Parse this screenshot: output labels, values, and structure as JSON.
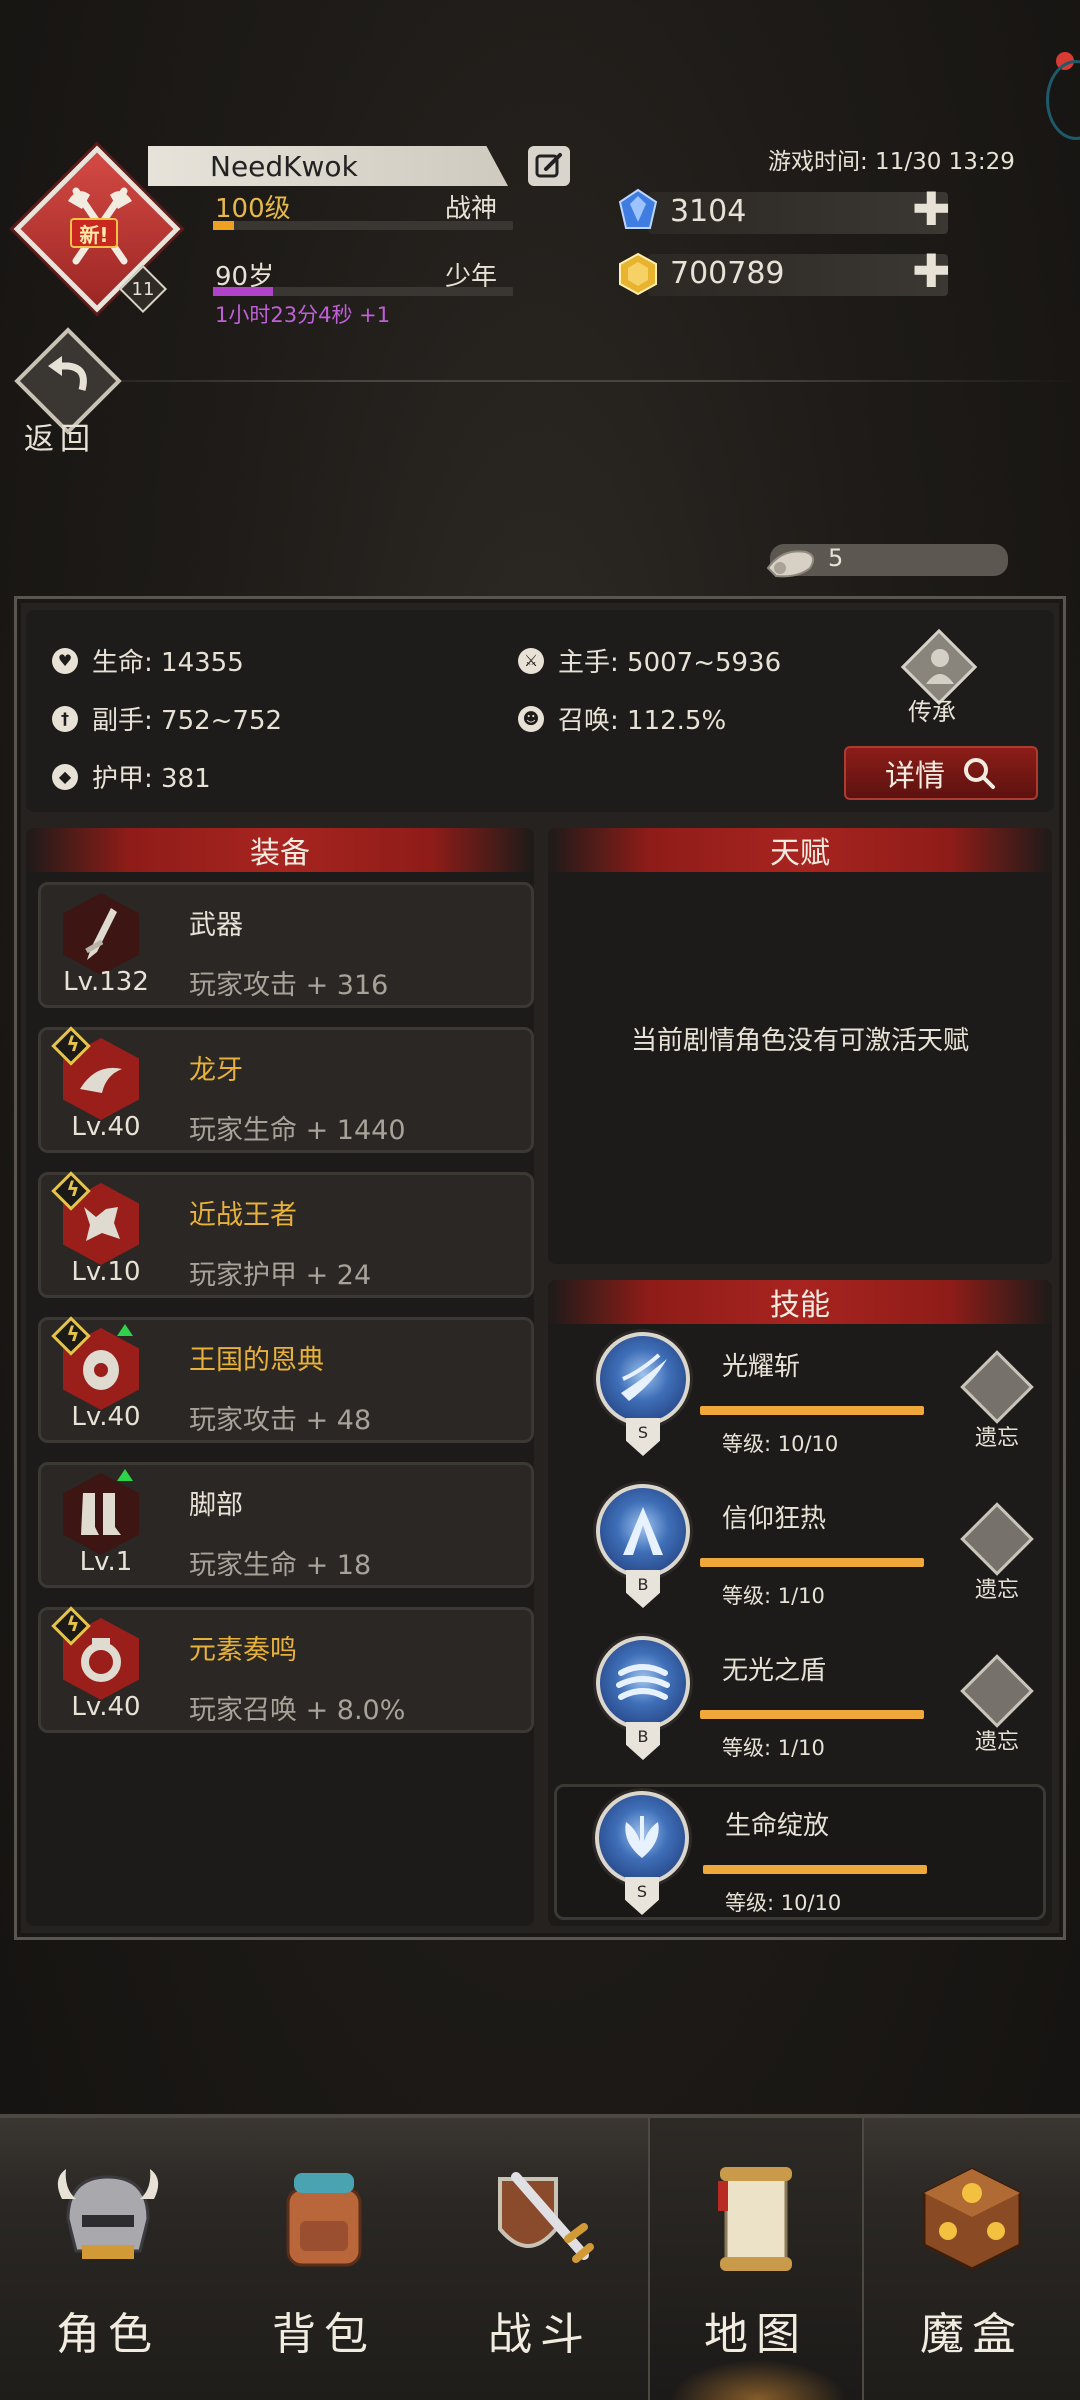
{
  "header": {
    "new_tag": "新!",
    "avatar_level": "11",
    "player_name": "NeedKwok",
    "level": "100级",
    "title": "战神",
    "exp_progress": 0.07,
    "age": "90岁",
    "stage": "少年",
    "age_progress": 0.2,
    "age_timer": "1小时23分4秒 +1",
    "game_time": "游戏时间: 11/30 13:29",
    "gems": "3104",
    "gold": "700789",
    "back_label": "返回",
    "scroll_count": "5"
  },
  "stats": {
    "hp": "生命: 14355",
    "main_hand": "主手: 5007~5936",
    "off_hand": "副手: 752~752",
    "summon": "召唤: 112.5%",
    "armor": "护甲: 381",
    "inherit_label": "传承",
    "detail_label": "详情"
  },
  "equipment": {
    "header": "装备",
    "items": [
      {
        "level": "Lv.132",
        "name": "武器",
        "stat": "玩家攻击 + 316"
      },
      {
        "level": "Lv.40",
        "name": "龙牙",
        "stat": "玩家生命 + 1440"
      },
      {
        "level": "Lv.10",
        "name": "近战王者",
        "stat": "玩家护甲 + 24"
      },
      {
        "level": "Lv.40",
        "name": "王国的恩典",
        "stat": "玩家攻击 + 48"
      },
      {
        "level": "Lv.1",
        "name": "脚部",
        "stat": "玩家生命 + 18"
      },
      {
        "level": "Lv.40",
        "name": "元素奏鸣",
        "stat": "玩家召唤 + 8.0%"
      }
    ]
  },
  "talent": {
    "header": "天赋",
    "empty_text": "当前剧情角色没有可激活天赋"
  },
  "skills": {
    "header": "技能",
    "forget_label": "遗忘",
    "items": [
      {
        "name": "光耀斩",
        "grade": "S",
        "level": "等级: 10/10"
      },
      {
        "name": "信仰狂热",
        "grade": "B",
        "level": "等级: 1/10"
      },
      {
        "name": "无光之盾",
        "grade": "B",
        "level": "等级: 1/10"
      },
      {
        "name": "生命绽放",
        "grade": "S",
        "level": "等级: 10/10"
      }
    ]
  },
  "nav": {
    "items": [
      {
        "label": "角色",
        "icon": "helmet-icon"
      },
      {
        "label": "背包",
        "icon": "backpack-icon"
      },
      {
        "label": "战斗",
        "icon": "sword-shield-icon"
      },
      {
        "label": "地图",
        "icon": "map-scroll-icon"
      },
      {
        "label": "魔盒",
        "icon": "magic-box-icon"
      }
    ],
    "active_index": 3
  },
  "colors": {
    "accent_red": "#a82420",
    "gold_text": "#e8b13a",
    "exp_bar": "#f0a020",
    "age_bar": "#b044c8"
  }
}
